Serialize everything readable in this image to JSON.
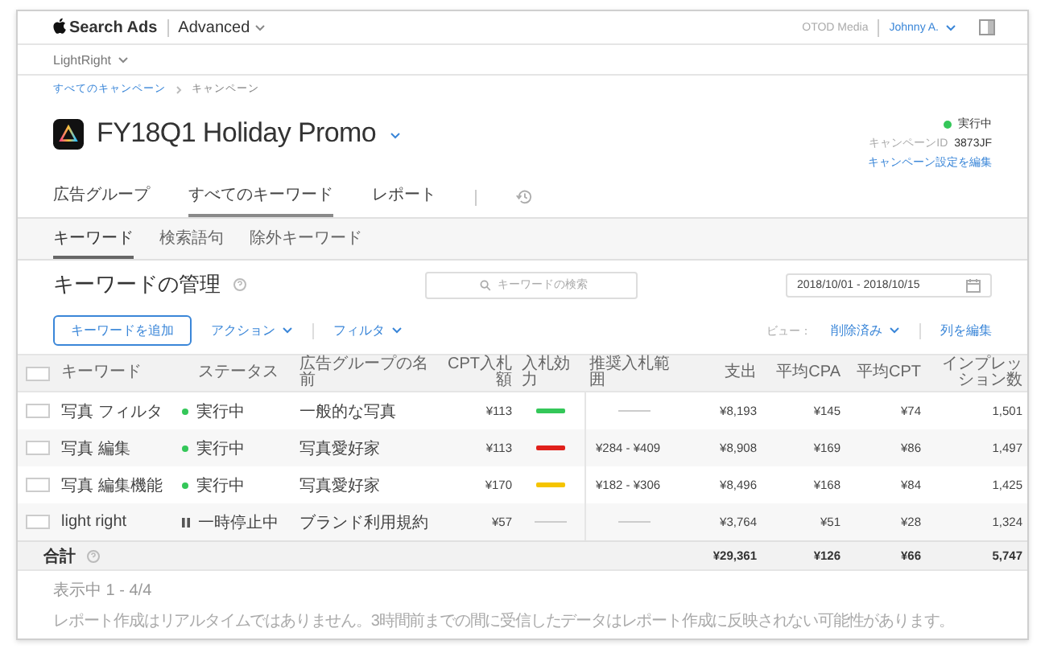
{
  "header": {
    "brand": "Search Ads",
    "product": "Advanced",
    "org": "OTOD Media",
    "user": "Johnny A."
  },
  "app_selector": {
    "label": "LightRight"
  },
  "breadcrumb": [
    {
      "label": "すべてのキャンペーン",
      "link": true
    },
    {
      "label": "キャンペーン",
      "link": false
    }
  ],
  "campaign": {
    "title": "FY18Q1 Holiday Promo",
    "status": "実行中",
    "id_label": "キャンペーンID",
    "id": "3873JF",
    "edit_link": "キャンペーン設定を編集"
  },
  "tabs": [
    {
      "label": "広告グループ",
      "selected": false
    },
    {
      "label": "すべてのキーワード",
      "selected": true
    },
    {
      "label": "レポート",
      "selected": false
    }
  ],
  "subtabs": [
    {
      "label": "キーワード",
      "selected": true
    },
    {
      "label": "検索語句",
      "selected": false
    },
    {
      "label": "除外キーワード",
      "selected": false
    }
  ],
  "section": {
    "title": "キーワードの管理",
    "search_placeholder": "キーワードの検索",
    "date_range": "2018/10/01 - 2018/10/15"
  },
  "toolbar": {
    "add_button": "キーワードを追加",
    "actions": "アクション",
    "filter": "フィルタ",
    "view_label": "ビュー：",
    "view_value": "削除済み",
    "edit_columns": "列を編集"
  },
  "table": {
    "select_all": {
      "checked": false
    },
    "columns": [
      "キーワード",
      "ステータス",
      "広告グループの名前",
      "CPT入札額",
      "入札効力",
      "推奨入札範囲",
      "支出",
      "平均CPA",
      "平均CPT",
      "インプレッション数"
    ],
    "rows": [
      {
        "checked": false,
        "keyword": "写真 フィルタ",
        "status": {
          "kind": "running",
          "label": "実行中"
        },
        "ad_group": "一般的な写真",
        "cpt_bid": "¥113",
        "bid_strength": {
          "kind": "bar",
          "color": "#34c759"
        },
        "spend": "¥8,193",
        "avg_cpa": "¥145",
        "avg_cpt": "¥74",
        "impressions": "1,501"
      },
      {
        "checked": false,
        "keyword": "写真 編集",
        "status": {
          "kind": "running",
          "label": "実行中"
        },
        "ad_group": "写真愛好家",
        "cpt_bid": "¥113",
        "bid_strength": {
          "kind": "bar",
          "color": "#e0201b"
        },
        "recommended_range": "¥284 - ¥409",
        "spend": "¥8,908",
        "avg_cpa": "¥169",
        "avg_cpt": "¥86",
        "impressions": "1,497"
      },
      {
        "checked": false,
        "keyword": "写真 編集機能",
        "status": {
          "kind": "running",
          "label": "実行中"
        },
        "ad_group": "写真愛好家",
        "cpt_bid": "¥170",
        "bid_strength": {
          "kind": "bar",
          "color": "#f5c400"
        },
        "recommended_range": "¥182 - ¥306",
        "spend": "¥8,496",
        "avg_cpa": "¥168",
        "avg_cpt": "¥84",
        "impressions": "1,425"
      },
      {
        "checked": false,
        "keyword": "light right",
        "status": {
          "kind": "paused",
          "label": "一時停止中"
        },
        "ad_group": "ブランド利用規約",
        "cpt_bid": "¥57",
        "bid_strength": {
          "kind": "none"
        },
        "spend": "¥3,764",
        "avg_cpa": "¥51",
        "avg_cpt": "¥28",
        "impressions": "1,324"
      }
    ],
    "total": {
      "label": "合計",
      "spend": "¥29,361",
      "avg_cpa": "¥126",
      "avg_cpt": "¥66",
      "impressions": "5,747"
    }
  },
  "footer": {
    "showing": "表示中 1 - 4/4",
    "note": "レポート作成はリアルタイムではありません。3時間前までの間に受信したデータはレポート作成に反映されない可能性があります。"
  }
}
